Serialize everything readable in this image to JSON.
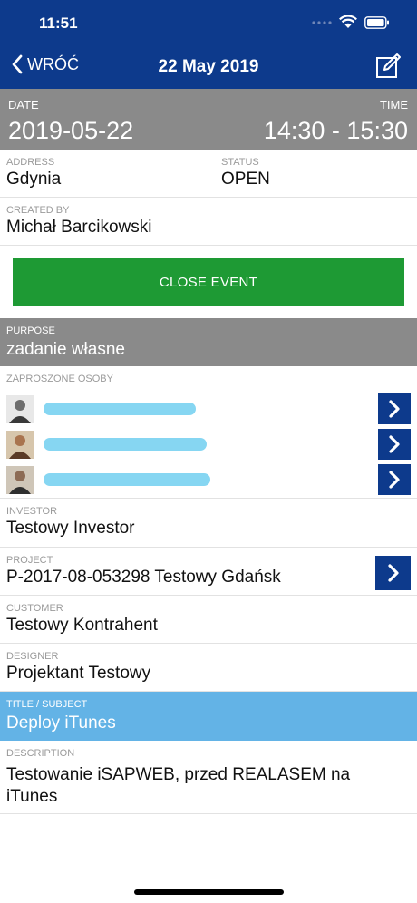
{
  "status_bar": {
    "time": "11:51"
  },
  "nav": {
    "back_label": "WRÓĆ",
    "title": "22 May 2019"
  },
  "event": {
    "date_label": "DATE",
    "date_value": "2019-05-22",
    "time_label": "TIME",
    "time_value": "14:30 - 15:30",
    "address_label": "ADDRESS",
    "address_value": "Gdynia",
    "status_label": "STATUS",
    "status_value": "OPEN",
    "created_label": "CREATED BY",
    "created_value": "Michał Barcikowski",
    "close_button": "CLOSE EVENT",
    "purpose_label": "PURPOSE",
    "purpose_value": "zadanie własne",
    "invited_label": "ZAPROSZONE OSOBY",
    "investor_label": "INVESTOR",
    "investor_value": "Testowy Investor",
    "project_label": "PROJECT",
    "project_value": "P-2017-08-053298 Testowy Gdańsk",
    "customer_label": "CUSTOMER",
    "customer_value": "Testowy Kontrahent",
    "designer_label": "DESIGNER",
    "designer_value": "Projektant Testowy",
    "title_label": "TITLE / SUBJECT",
    "title_value": "Deploy iTunes",
    "description_label": "DESCRIPTION",
    "description_value": "Testowanie iSAPWEB, przed REALASEM na iTunes"
  },
  "colors": {
    "nav": "#0d3a8c",
    "band_gray": "#8a8a8a",
    "close_green": "#1e9a34",
    "title_blue": "#63b3e6",
    "redaction": "#7fd4f1"
  }
}
